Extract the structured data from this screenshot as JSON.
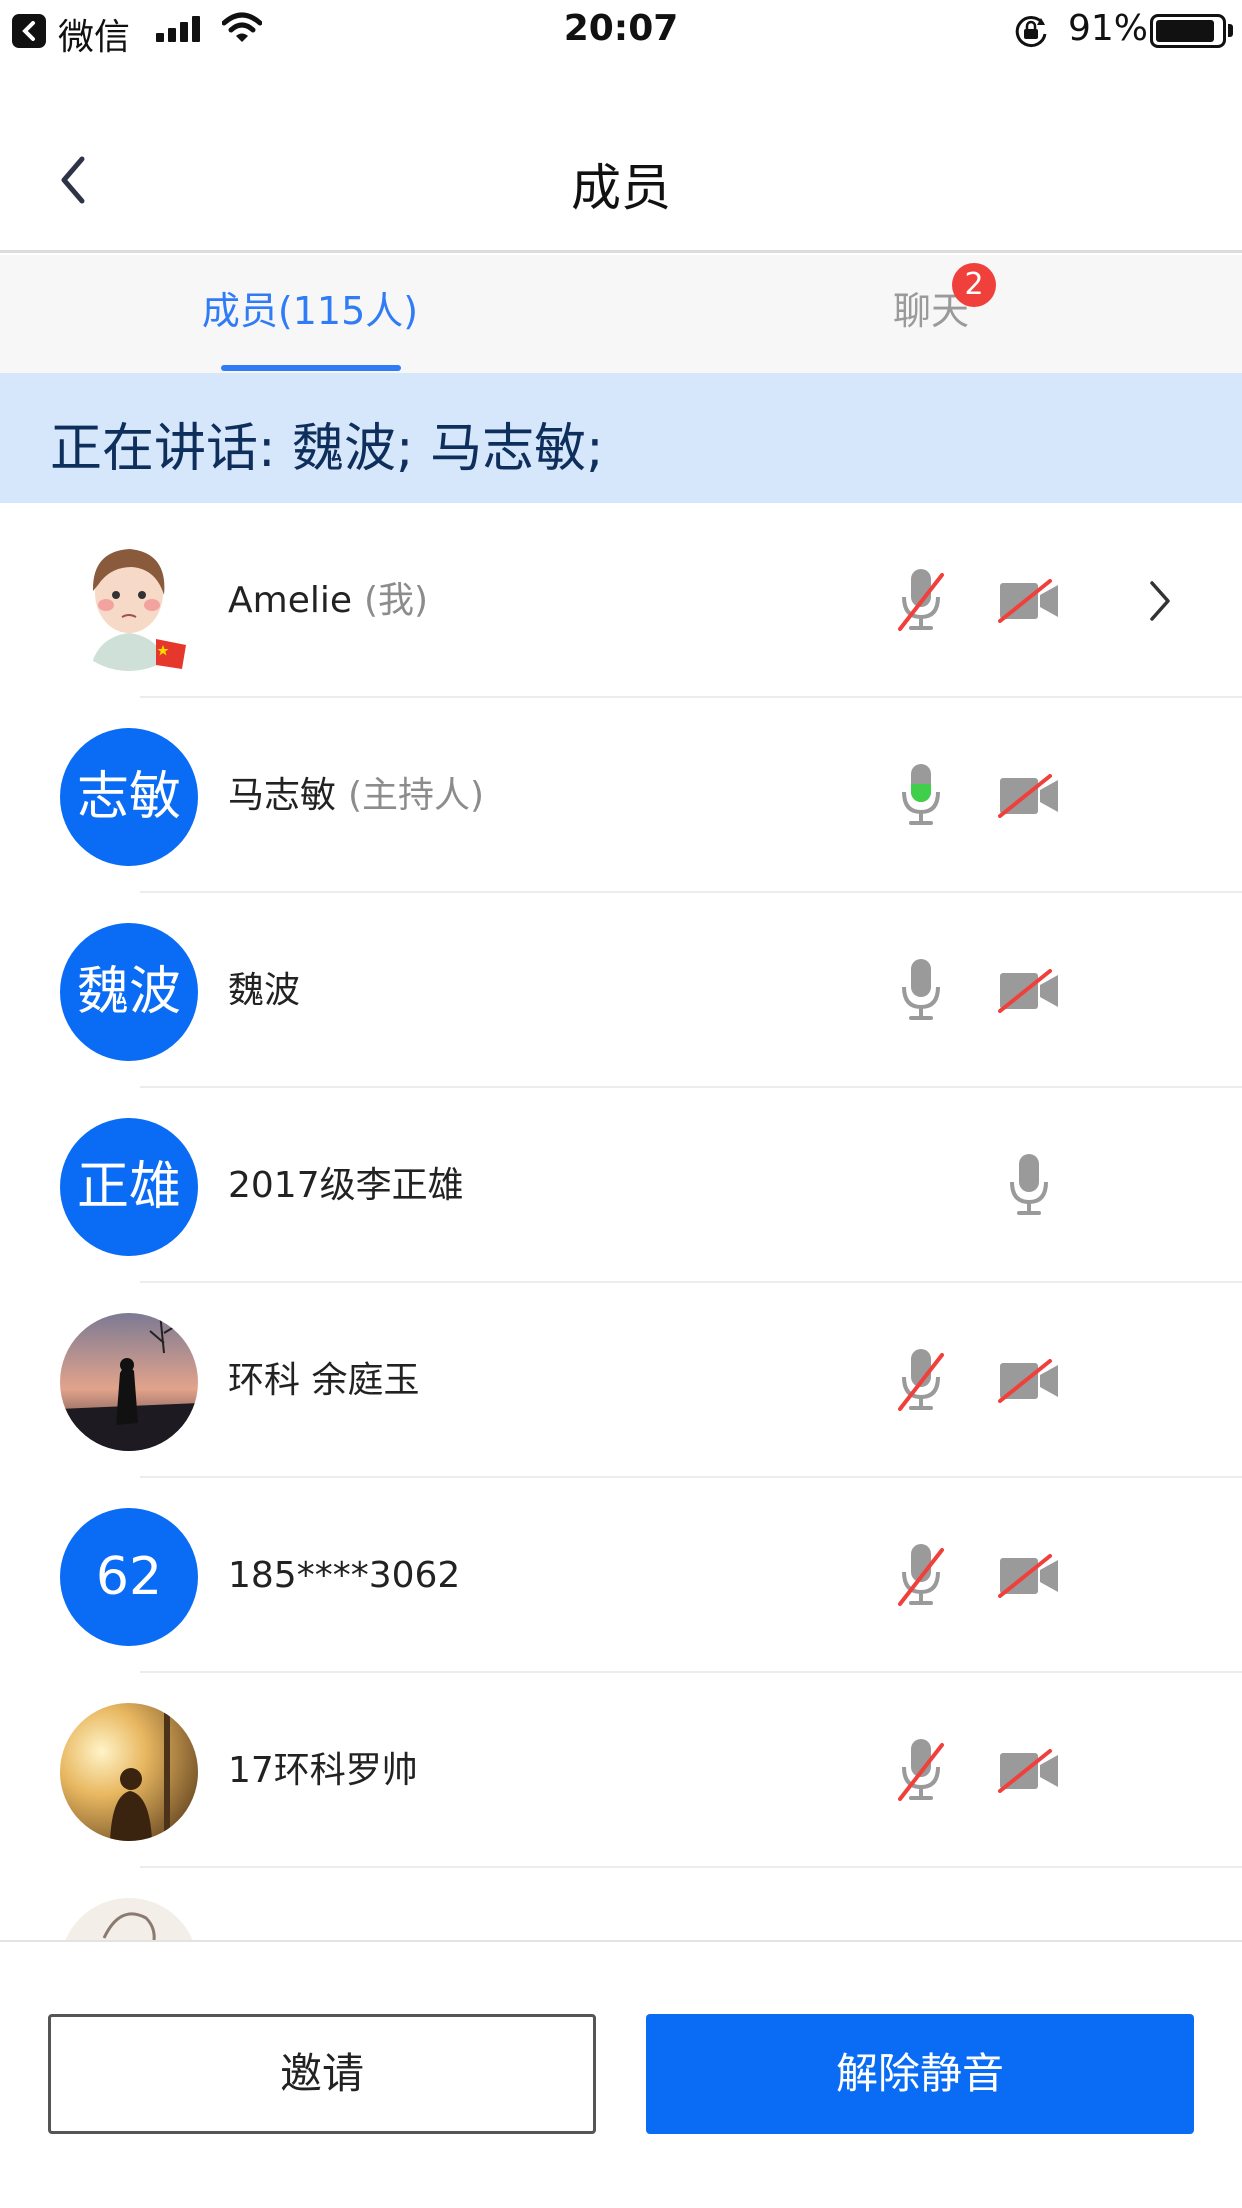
{
  "status_bar": {
    "app_name": "微信",
    "time": "20:07",
    "battery_percent": "91%",
    "battery_level": 0.91
  },
  "nav": {
    "title": "成员",
    "back_icon": "chevron-left-icon"
  },
  "tabs": {
    "members_label": "成员(115人)",
    "chat_label": "聊天",
    "chat_badge": "2",
    "active": "members"
  },
  "speaking": {
    "text": "正在讲话: 魏波; 马志敏;"
  },
  "members": [
    {
      "name": "Amelie",
      "tag": "(我)",
      "avatar": "photo-cartoon-girl",
      "mic": "muted",
      "camera": "off",
      "chevron": true
    },
    {
      "name": "马志敏",
      "tag": "(主持人)",
      "avatar_text": "志敏",
      "mic": "speaking",
      "camera": "off"
    },
    {
      "name": "魏波",
      "tag": "",
      "avatar_text": "魏波",
      "mic": "on",
      "camera": "off"
    },
    {
      "name": "2017级李正雄",
      "tag": "",
      "avatar_text": "正雄",
      "mic": "on",
      "camera": "none"
    },
    {
      "name": " 环科 余庭玉",
      "tag": "",
      "avatar": "photo-sunset-silhouette",
      "mic": "muted",
      "camera": "off"
    },
    {
      "name": "185****3062",
      "tag": "",
      "avatar_text": "62",
      "mic": "muted",
      "camera": "off"
    },
    {
      "name": "17环科罗帅",
      "tag": "",
      "avatar": "photo-sunlight-person",
      "mic": "muted",
      "camera": "off"
    }
  ],
  "buttons": {
    "invite": "邀请",
    "unmute": "解除静音"
  },
  "colors": {
    "accent": "#0a6cf5",
    "tab_active": "#2f7cf6",
    "banner_bg": "#d6e7fb",
    "muted_slash": "#f0403c",
    "speaking_green": "#3fcf4b",
    "badge": "#f0403c"
  }
}
